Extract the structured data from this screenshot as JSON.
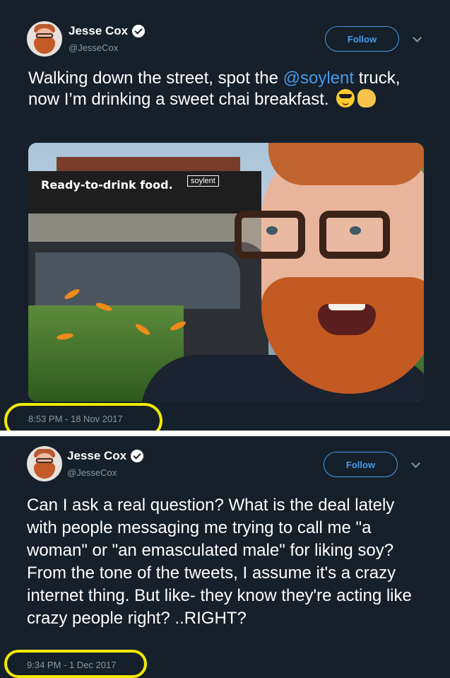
{
  "tweets": [
    {
      "user_name": "Jesse Cox",
      "handle": "@JesseCox",
      "follow_label": "Follow",
      "text_before_mention": "Walking down the street, spot the ",
      "mention": "@soylent",
      "text_after_mention": " truck, now I’m drinking a sweet chai breakfast.",
      "emojis": [
        "smiling-face-with-sunglasses",
        "call-me-hand"
      ],
      "photo": {
        "sign_text": "Ready-to-drink food.",
        "brand_text": "soylent"
      },
      "timestamp": "8:53 PM - 18 Nov 2017"
    },
    {
      "user_name": "Jesse Cox",
      "handle": "@JesseCox",
      "follow_label": "Follow",
      "text": "Can I ask a real question? What is the deal lately with people messaging me trying to call me \"a woman\" or \"an emasculated male\" for liking soy? From the tone of the tweets, I assume it's a crazy internet thing. But like- they know they're acting like crazy people right? ..RIGHT?",
      "timestamp": "9:34 PM - 1 Dec 2017"
    }
  ],
  "colors": {
    "background": "#15202b",
    "accent": "#4a99e9",
    "muted_text": "#8899a6",
    "highlight": "#f2ea00"
  }
}
